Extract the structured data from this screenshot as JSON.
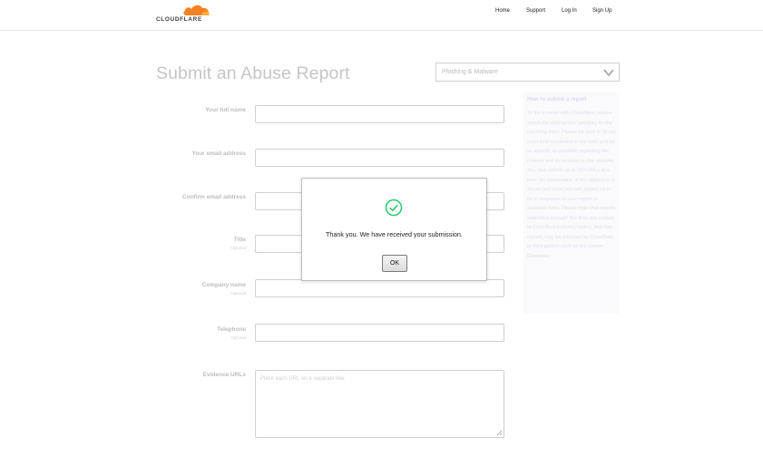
{
  "header": {
    "logo_text": "CLOUDFLARE",
    "nav": {
      "home": "Home",
      "support": "Support",
      "login": "Log In",
      "signup": "Sign Up"
    }
  },
  "page": {
    "title": "Submit an Abuse Report",
    "category": {
      "selected": "Phishing & Malware"
    }
  },
  "form": {
    "full_name_label": "Your full name",
    "email_label": "Your email address",
    "confirm_email_label": "Confirm email address",
    "title_label": "Title",
    "company_label": "Company name",
    "telephone_label": "Telephone",
    "optional": "Optional",
    "evidence_label": "Evidence URLs",
    "evidence_placeholder": "Place each URL on a separate line."
  },
  "help": {
    "title": "How to submit a report",
    "body": "To file a report with Cloudflare, please select the appropriate category on the reporting form. Please be sure to fill out each field requested in the form and be as specific as possible regarding the content and its location on the website. You may submit up to 250 URLs at a time. An explanation of our approach to abuse and what you can expect us to do in response to your report is available here. Please note that reports submitted through this form are subject to Cloudflare's privacy policy, and that reports may be released by Cloudflare to third parties such as the Lumen Database."
  },
  "modal": {
    "message": "Thank you. We have received your submission.",
    "ok_label": "OK"
  },
  "colors": {
    "brand_orange": "#f48120",
    "success_green": "#2ecc71"
  }
}
